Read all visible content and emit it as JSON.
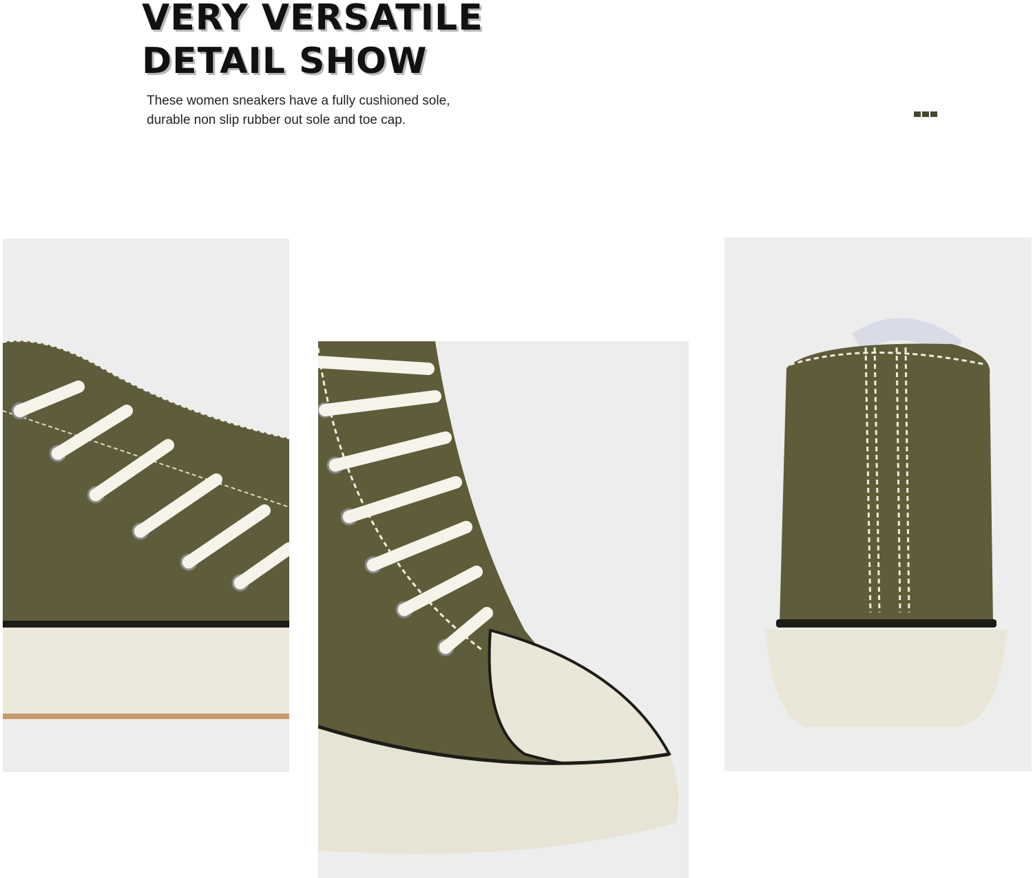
{
  "header": {
    "title_line1": "VERY VERSATILE",
    "title_line2": "DETAIL SHOW",
    "description_line1": "These women sneakers have a fully cushioned sole,",
    "description_line2": "durable non slip rubber out sole and toe cap."
  },
  "colors": {
    "canvas": "#olive",
    "olive": "#5f5c3a",
    "swatch_dots": [
      "#46462e",
      "#46462e",
      "#46462e"
    ]
  },
  "photos": [
    {
      "name": "side-lace-closeup",
      "subject": "olive high-top canvas sneaker, lacing and side"
    },
    {
      "name": "toe-cap-closeup",
      "subject": "olive high-top canvas sneaker, front with rubber toe cap"
    },
    {
      "name": "heel-back-view",
      "subject": "olive high-top canvas sneaker, back heel view"
    }
  ]
}
